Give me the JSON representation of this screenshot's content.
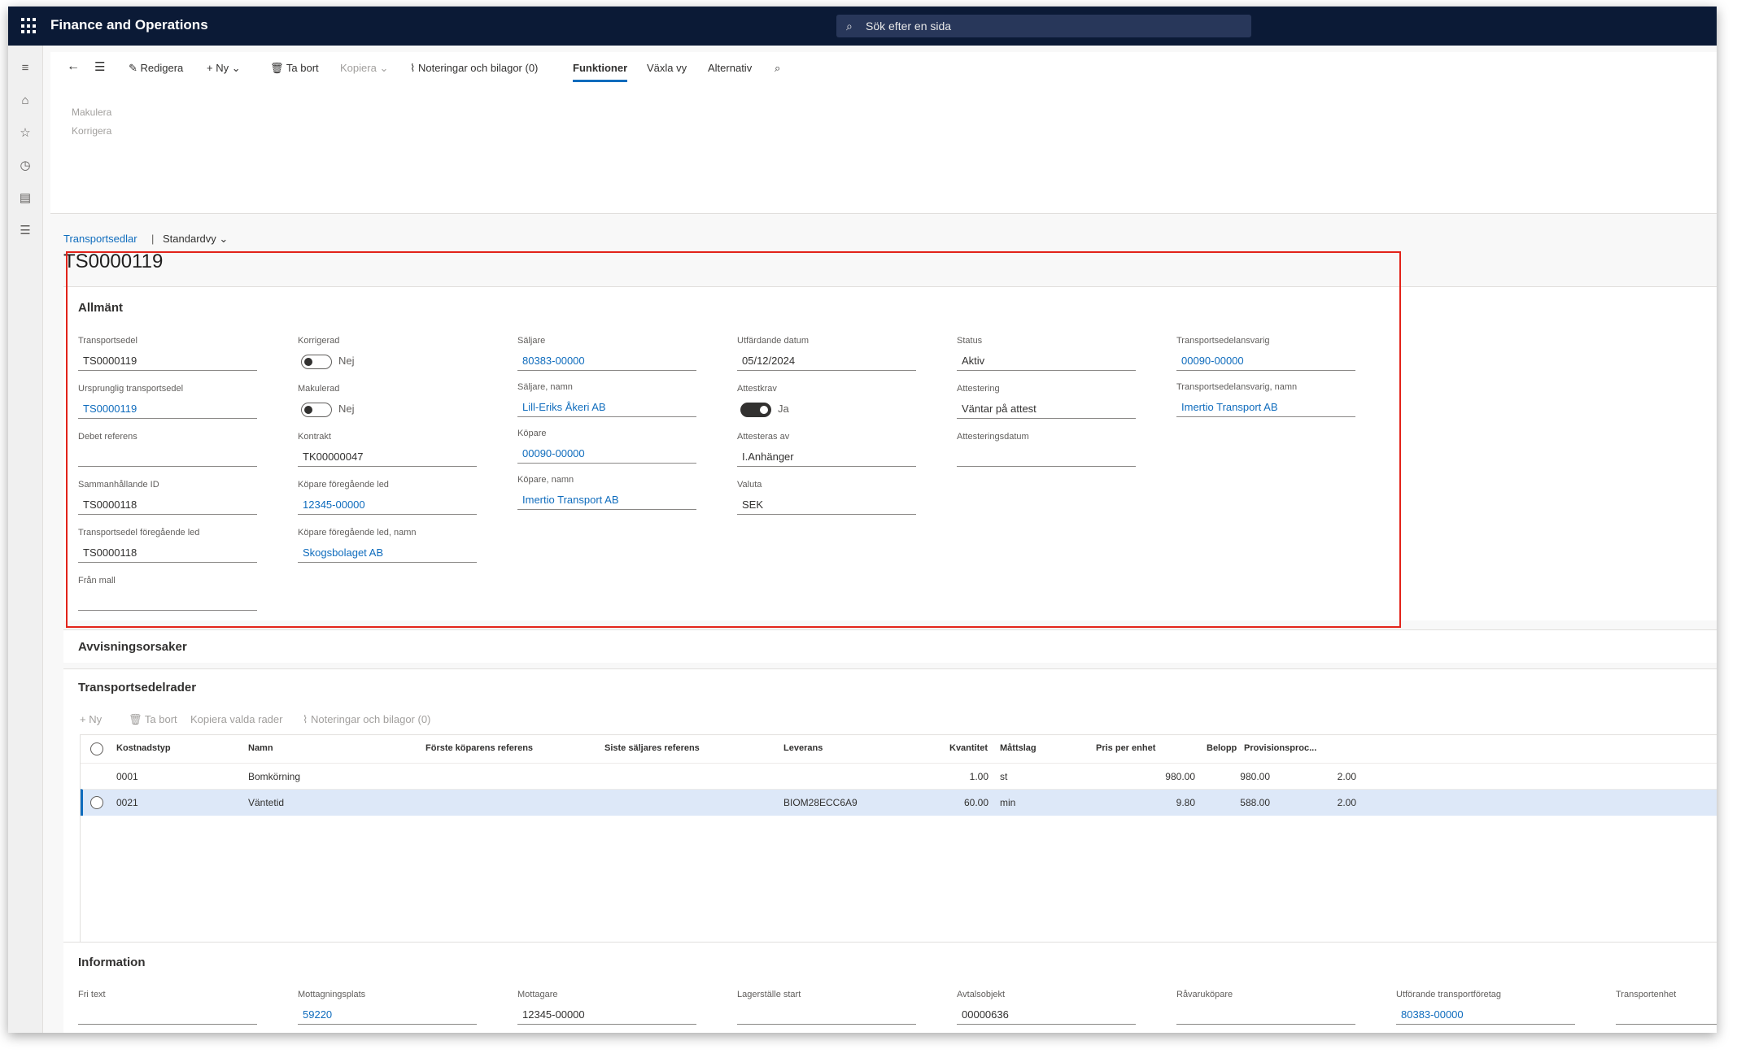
{
  "app": {
    "title": "Finance and Operations",
    "search_placeholder": "Sök efter en sida"
  },
  "toolbar": {
    "edit": "Redigera",
    "new": "Ny",
    "delete": "Ta bort",
    "copy": "Kopiera",
    "notes": "Noteringar och bilagor (0)",
    "functions": "Funktioner",
    "switch_view": "Växla vy",
    "options": "Alternativ",
    "sub_items": [
      "Makulera",
      "Korrigera"
    ]
  },
  "breadcrumb": {
    "link": "Transportsedlar",
    "separator": "|",
    "view": "Standardvy"
  },
  "record": {
    "id": "TS0000119"
  },
  "general": {
    "header": "Allmänt",
    "col1": [
      {
        "label": "Transportsedel",
        "value": "TS0000119"
      },
      {
        "label": "Ursprunglig transportsedel",
        "value": "TS0000119"
      },
      {
        "label": "Debet referens",
        "value": ""
      },
      {
        "label": "Sammanhållande ID",
        "value": "TS0000118"
      },
      {
        "label": "Transportsedel föregående led",
        "value": "TS0000118"
      },
      {
        "label": "Från mall",
        "value": ""
      }
    ],
    "corrected": {
      "label": "Korrigerad",
      "value": "Nej"
    },
    "cancelled": {
      "label": "Makulerad",
      "value": "Nej"
    },
    "contract": {
      "label": "Kontrakt",
      "value": "TK00000047"
    },
    "buyer_prev": {
      "label": "Köpare föregående led",
      "value": "12345-00000"
    },
    "buyer_prev_name": {
      "label": "Köpare föregående led, namn",
      "value": "Skogsbolaget AB"
    },
    "seller": {
      "label": "Säljare",
      "value": "80383-00000"
    },
    "seller_name": {
      "label": "Säljare, namn",
      "value": "Lill-Eriks Åkeri AB"
    },
    "buyer": {
      "label": "Köpare",
      "value": "00090-00000"
    },
    "buyer_name": {
      "label": "Köpare, namn",
      "value": "Imertio Transport AB"
    },
    "issue_date": {
      "label": "Utfärdande datum",
      "value": "05/12/2024"
    },
    "attest_req": {
      "label": "Attestkrav",
      "value": "Ja"
    },
    "attested_by": {
      "label": "Attesteras av",
      "value": "I.Anhänger"
    },
    "currency": {
      "label": "Valuta",
      "value": "SEK"
    },
    "status": {
      "label": "Status",
      "value": "Aktiv"
    },
    "attestation": {
      "label": "Attestering",
      "value": "Väntar på attest"
    },
    "attest_date": {
      "label": "Attesteringsdatum",
      "value": ""
    },
    "responsible": {
      "label": "Transportsedelansvarig",
      "value": "00090-00000"
    },
    "responsible_name": {
      "label": "Transportsedelansvarig, namn",
      "value": "Imertio Transport AB"
    }
  },
  "rejection": {
    "header": "Avvisningsorsaker"
  },
  "lines": {
    "header": "Transportsedelrader",
    "toolbar": {
      "new": "Ny",
      "delete": "Ta bort",
      "copy": "Kopiera valda rader",
      "notes": "Noteringar och bilagor (0)"
    },
    "columns": [
      "Kostnadstyp",
      "Namn",
      "Förste köparens referens",
      "Siste säljares referens",
      "Leverans",
      "Kvantitet",
      "Måttslag",
      "Pris per enhet",
      "Belopp",
      "Provisionsproc..."
    ],
    "rows": [
      {
        "type": "0001",
        "name": "Bomkörning",
        "delivery": "",
        "qty": "1.00",
        "unit": "st",
        "price": "980.00",
        "amount": "980.00",
        "comm": "2.00"
      },
      {
        "type": "0021",
        "name": "Väntetid",
        "delivery": "BIOM28ECC6A9",
        "qty": "60.00",
        "unit": "min",
        "price": "9.80",
        "amount": "588.00",
        "comm": "2.00"
      }
    ]
  },
  "info": {
    "header": "Information",
    "fields": [
      {
        "label": "Fri text",
        "value": ""
      },
      {
        "label": "Mottagningsplats",
        "value": "59220"
      },
      {
        "label": "Mottagare",
        "value": "12345-00000"
      },
      {
        "label": "Lagerställe start",
        "value": ""
      },
      {
        "label": "Avtalsobjekt",
        "value": "00000636"
      },
      {
        "label": "Råvaruköpare",
        "value": ""
      },
      {
        "label": "Utförande transportföretag",
        "value": "80383-00000"
      },
      {
        "label": "Transportenhet",
        "value": ""
      }
    ]
  }
}
